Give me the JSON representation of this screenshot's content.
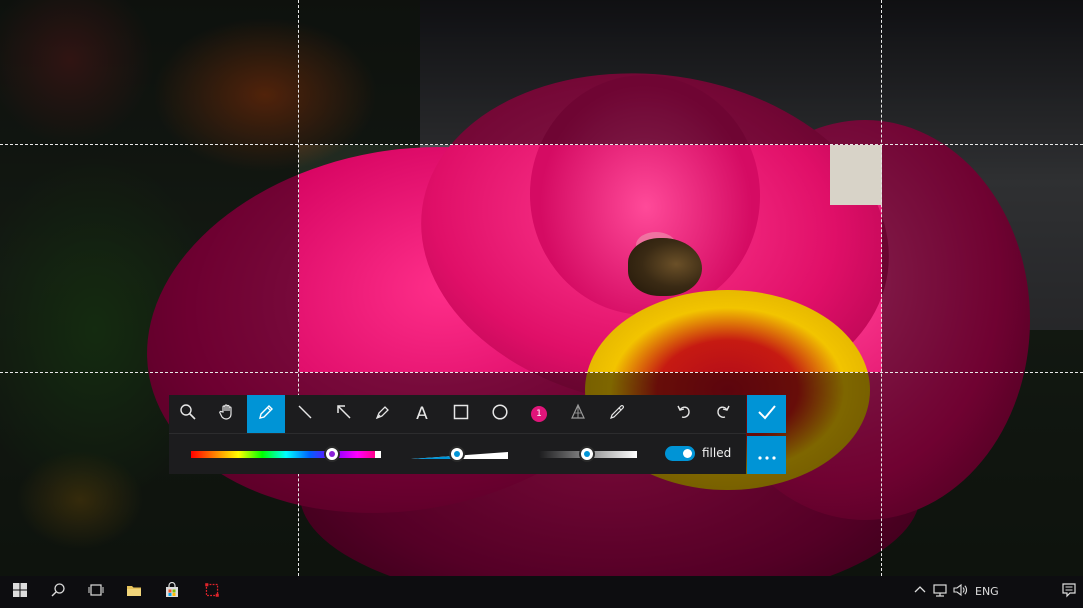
{
  "toolbar": {
    "tools": [
      {
        "name": "zoom",
        "icon": "magnifier-icon"
      },
      {
        "name": "pan",
        "icon": "hand-icon"
      },
      {
        "name": "pen",
        "icon": "pencil-icon",
        "active": true
      },
      {
        "name": "line",
        "icon": "line-icon"
      },
      {
        "name": "arrow",
        "icon": "arrow-icon"
      },
      {
        "name": "marker",
        "icon": "marker-icon"
      },
      {
        "name": "text",
        "icon": "text-icon",
        "glyph": "A"
      },
      {
        "name": "rectangle",
        "icon": "rectangle-icon"
      },
      {
        "name": "ellipse",
        "icon": "ellipse-icon"
      },
      {
        "name": "counter",
        "icon": "numbered-step-icon",
        "glyph": "1"
      },
      {
        "name": "blur",
        "icon": "blur-icon"
      },
      {
        "name": "color-picker",
        "icon": "eyedropper-icon"
      },
      {
        "name": "undo",
        "icon": "undo-icon"
      },
      {
        "name": "redo",
        "icon": "redo-icon"
      }
    ],
    "filled_label": "filled",
    "filled_on": true,
    "color_position": 0.74,
    "size_position": 0.47,
    "opacity_position": 0.49,
    "selected_color": "#8a1fd6",
    "accent_color": "#0094d6",
    "counter_color": "#e0157a"
  },
  "taskbar": {
    "language": "ENG"
  }
}
